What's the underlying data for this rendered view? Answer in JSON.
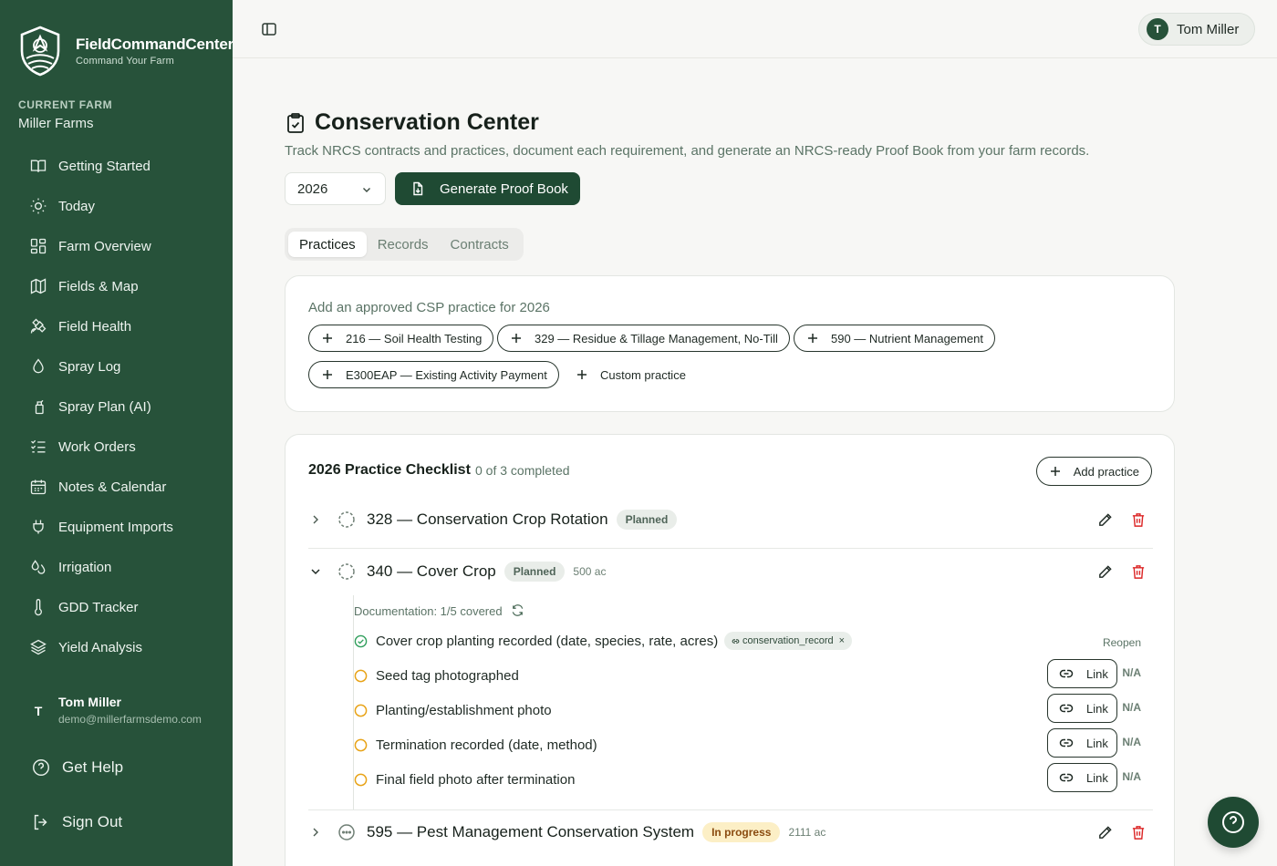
{
  "app": {
    "name": "FieldCommandCenter",
    "tagline": "Command Your Farm"
  },
  "farm": {
    "label": "CURRENT FARM",
    "name": "Miller Farms"
  },
  "sidebar": {
    "items": [
      {
        "label": "Getting Started",
        "icon": "book-open-icon"
      },
      {
        "label": "Today",
        "icon": "sun-icon"
      },
      {
        "label": "Farm Overview",
        "icon": "dashboard-icon"
      },
      {
        "label": "Fields & Map",
        "icon": "map-icon"
      },
      {
        "label": "Field Health",
        "icon": "satellite-icon"
      },
      {
        "label": "Spray Log",
        "icon": "droplet-icon"
      },
      {
        "label": "Spray Plan (AI)",
        "icon": "spray-bottle-icon"
      },
      {
        "label": "Work Orders",
        "icon": "list-checks-icon"
      },
      {
        "label": "Notes & Calendar",
        "icon": "calendar-icon"
      },
      {
        "label": "Equipment Imports",
        "icon": "plug-icon"
      },
      {
        "label": "Irrigation",
        "icon": "droplets-icon"
      },
      {
        "label": "GDD Tracker",
        "icon": "thermometer-icon"
      },
      {
        "label": "Yield Analysis",
        "icon": "layers-icon"
      }
    ],
    "user": {
      "initial": "T",
      "name": "Tom Miller",
      "email": "demo@millerfarmsdemo.com"
    },
    "help_label": "Get Help",
    "signout_label": "Sign Out"
  },
  "topbar": {
    "user_initial": "T",
    "user_name": "Tom Miller"
  },
  "page": {
    "title": "Conservation Center",
    "subtitle": "Track NRCS contracts and practices, document each requirement, and generate an NRCS-ready Proof Book from your farm records.",
    "year": "2026",
    "generate_label": "Generate Proof Book",
    "tabs": [
      "Practices",
      "Records",
      "Contracts"
    ],
    "active_tab": "Practices"
  },
  "add_card": {
    "heading": "Add an approved CSP practice for 2026",
    "chips": [
      "216 — Soil Health Testing",
      "329 — Residue & Tillage Management, No-Till",
      "590 — Nutrient Management",
      "E300EAP — Existing Activity Payment"
    ],
    "custom_label": "Custom practice"
  },
  "checklist": {
    "title": "2026 Practice Checklist",
    "count": "0 of 3 completed",
    "add_label": "Add practice",
    "practices": [
      {
        "name": "328 — Conservation Crop Rotation",
        "status": "Planned",
        "acres": ""
      },
      {
        "name": "340 — Cover Crop",
        "status": "Planned",
        "acres": "500 ac"
      },
      {
        "name": "595 — Pest Management Conservation System",
        "status": "In progress",
        "acres": "2111 ac"
      }
    ],
    "documentation": {
      "label": "Documentation: 1/5 covered",
      "items": [
        {
          "text": "Cover crop planting recorded (date, species, rate, acres)",
          "done": true,
          "tag": "conservation_record",
          "action": "Reopen"
        },
        {
          "text": "Seed tag photographed",
          "done": false,
          "link_label": "Link",
          "na_label": "N/A"
        },
        {
          "text": "Planting/establishment photo",
          "done": false,
          "link_label": "Link",
          "na_label": "N/A"
        },
        {
          "text": "Termination recorded (date, method)",
          "done": false,
          "link_label": "Link",
          "na_label": "N/A"
        },
        {
          "text": "Final field photo after termination",
          "done": false,
          "link_label": "Link",
          "na_label": "N/A"
        }
      ]
    }
  },
  "colors": {
    "sidebar_bg": "#27523a",
    "primary": "#1f4a33",
    "pending": "#e8a317",
    "done": "#2f9e5b",
    "delete": "#dc2626"
  }
}
